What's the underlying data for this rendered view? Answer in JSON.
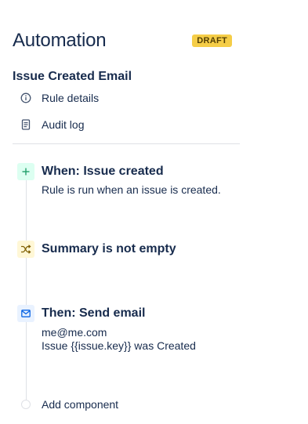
{
  "header": {
    "title": "Automation",
    "badge": "DRAFT"
  },
  "rule": {
    "name": "Issue Created Email"
  },
  "menu": {
    "items": [
      {
        "label": "Rule details",
        "icon": "info-icon"
      },
      {
        "label": "Audit log",
        "icon": "document-icon"
      }
    ]
  },
  "steps": [
    {
      "type": "trigger",
      "icon": "plus-icon",
      "title": "When: Issue created",
      "description": [
        "Rule is run when an issue is created."
      ]
    },
    {
      "type": "condition",
      "icon": "shuffle-icon",
      "title": "Summary is not empty",
      "description": []
    },
    {
      "type": "action",
      "icon": "mail-icon",
      "title": "Then: Send email",
      "description": [
        "me@me.com",
        "Issue {{issue.key}} was Created"
      ]
    }
  ],
  "add_component": {
    "label": "Add component"
  },
  "colors": {
    "text": "#172b4d",
    "draft_badge_bg": "#f5cd47",
    "trigger_bg": "#dcfff1",
    "trigger_icon": "#22a06b",
    "condition_bg": "#fff7d6",
    "condition_icon": "#7f5f01",
    "action_bg": "#e9f2ff",
    "action_icon": "#0c66e4",
    "divider": "#dfe1e6"
  }
}
